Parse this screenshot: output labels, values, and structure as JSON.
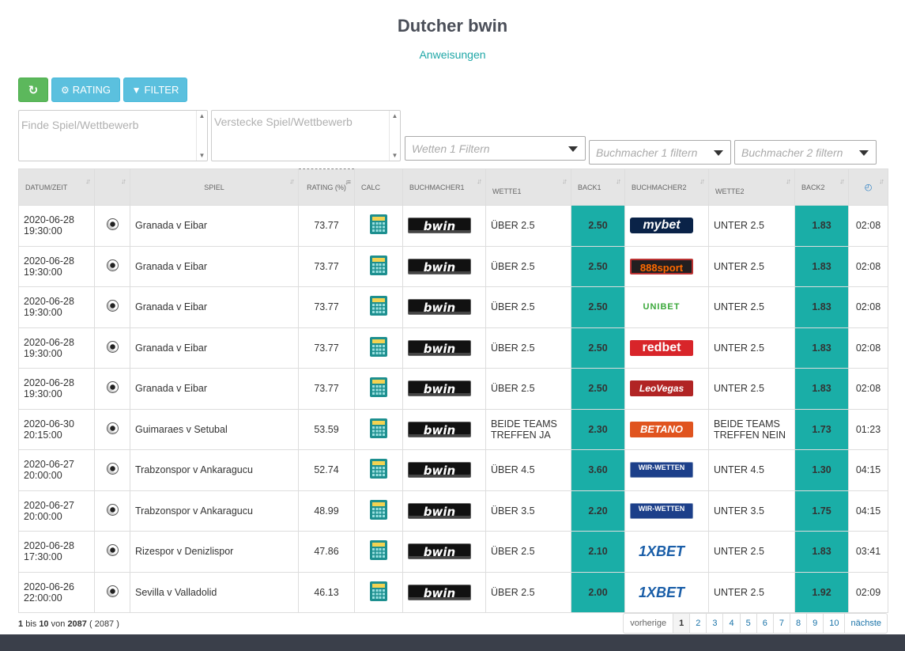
{
  "header": {
    "title": "Dutcher bwin",
    "instructions_link": "Anweisungen"
  },
  "toolbar": {
    "rating_label": "RATING",
    "filter_label": "FILTER"
  },
  "filters": {
    "find_placeholder": "Finde Spiel/Wettbewerb",
    "hide_placeholder": "Verstecke Spiel/Wettbewerb",
    "bet1_filter": "Wetten 1 Filtern",
    "bookmaker1_filter": "Buchmacher 1 filtern",
    "bookmaker2_filter": "Buchmacher 2 filtern"
  },
  "table": {
    "columns": [
      "DATUM/ZEIT",
      "",
      "SPIEL",
      "RATING (%)",
      "CALC",
      "BUCHMACHER1",
      "WETTE1",
      "BACK1",
      "BUCHMACHER2",
      "WETTE2",
      "BACK2",
      "clock-icon"
    ],
    "rows": [
      {
        "date": "2020-06-28",
        "time": "19:30:00",
        "match": "Granada v Eibar",
        "rating": "73.77",
        "bookmaker1": "bwin",
        "bet1": "ÜBER 2.5",
        "back1": "2.50",
        "bookmaker2": "mybet",
        "bet2": "UNTER 2.5",
        "back2": "1.83",
        "countdown": "02:08"
      },
      {
        "date": "2020-06-28",
        "time": "19:30:00",
        "match": "Granada v Eibar",
        "rating": "73.77",
        "bookmaker1": "bwin",
        "bet1": "ÜBER 2.5",
        "back1": "2.50",
        "bookmaker2": "888sport",
        "bet2": "UNTER 2.5",
        "back2": "1.83",
        "countdown": "02:08"
      },
      {
        "date": "2020-06-28",
        "time": "19:30:00",
        "match": "Granada v Eibar",
        "rating": "73.77",
        "bookmaker1": "bwin",
        "bet1": "ÜBER 2.5",
        "back1": "2.50",
        "bookmaker2": "UNIBET",
        "bet2": "UNTER 2.5",
        "back2": "1.83",
        "countdown": "02:08"
      },
      {
        "date": "2020-06-28",
        "time": "19:30:00",
        "match": "Granada v Eibar",
        "rating": "73.77",
        "bookmaker1": "bwin",
        "bet1": "ÜBER 2.5",
        "back1": "2.50",
        "bookmaker2": "redbet",
        "bet2": "UNTER 2.5",
        "back2": "1.83",
        "countdown": "02:08"
      },
      {
        "date": "2020-06-28",
        "time": "19:30:00",
        "match": "Granada v Eibar",
        "rating": "73.77",
        "bookmaker1": "bwin",
        "bet1": "ÜBER 2.5",
        "back1": "2.50",
        "bookmaker2": "LeoVegas",
        "bet2": "UNTER 2.5",
        "back2": "1.83",
        "countdown": "02:08"
      },
      {
        "date": "2020-06-30",
        "time": "20:15:00",
        "match": "Guimaraes v Setubal",
        "rating": "53.59",
        "bookmaker1": "bwin",
        "bet1": "BEIDE TEAMS TREFFEN JA",
        "back1": "2.30",
        "bookmaker2": "BETANO",
        "bet2": "BEIDE TEAMS TREFFEN NEIN",
        "back2": "1.73",
        "countdown": "01:23"
      },
      {
        "date": "2020-06-27",
        "time": "20:00:00",
        "match": "Trabzonspor v Ankaragucu",
        "rating": "52.74",
        "bookmaker1": "bwin",
        "bet1": "ÜBER 4.5",
        "back1": "3.60",
        "bookmaker2": "WIR-WETTEN",
        "bet2": "UNTER 4.5",
        "back2": "1.30",
        "countdown": "04:15"
      },
      {
        "date": "2020-06-27",
        "time": "20:00:00",
        "match": "Trabzonspor v Ankaragucu",
        "rating": "48.99",
        "bookmaker1": "bwin",
        "bet1": "ÜBER 3.5",
        "back1": "2.20",
        "bookmaker2": "WIR-WETTEN",
        "bet2": "UNTER 3.5",
        "back2": "1.75",
        "countdown": "04:15"
      },
      {
        "date": "2020-06-28",
        "time": "17:30:00",
        "match": "Rizespor v Denizlispor",
        "rating": "47.86",
        "bookmaker1": "bwin",
        "bet1": "ÜBER 2.5",
        "back1": "2.10",
        "bookmaker2": "1XBET",
        "bet2": "UNTER 2.5",
        "back2": "1.83",
        "countdown": "03:41"
      },
      {
        "date": "2020-06-26",
        "time": "22:00:00",
        "match": "Sevilla v Valladolid",
        "rating": "46.13",
        "bookmaker1": "bwin",
        "bet1": "ÜBER 2.5",
        "back1": "2.00",
        "bookmaker2": "1XBET",
        "bet2": "UNTER 2.5",
        "back2": "1.92",
        "countdown": "02:09"
      }
    ]
  },
  "footer": {
    "info": {
      "start": "1",
      "bis": "bis",
      "end": "10",
      "von": "von",
      "total": "2087",
      "total_paren": "( 2087 )"
    },
    "pager": {
      "prev": "vorherige",
      "pages": [
        "1",
        "2",
        "3",
        "4",
        "5",
        "6",
        "7",
        "8",
        "9",
        "10"
      ],
      "next": "nächste",
      "active": "1"
    }
  }
}
